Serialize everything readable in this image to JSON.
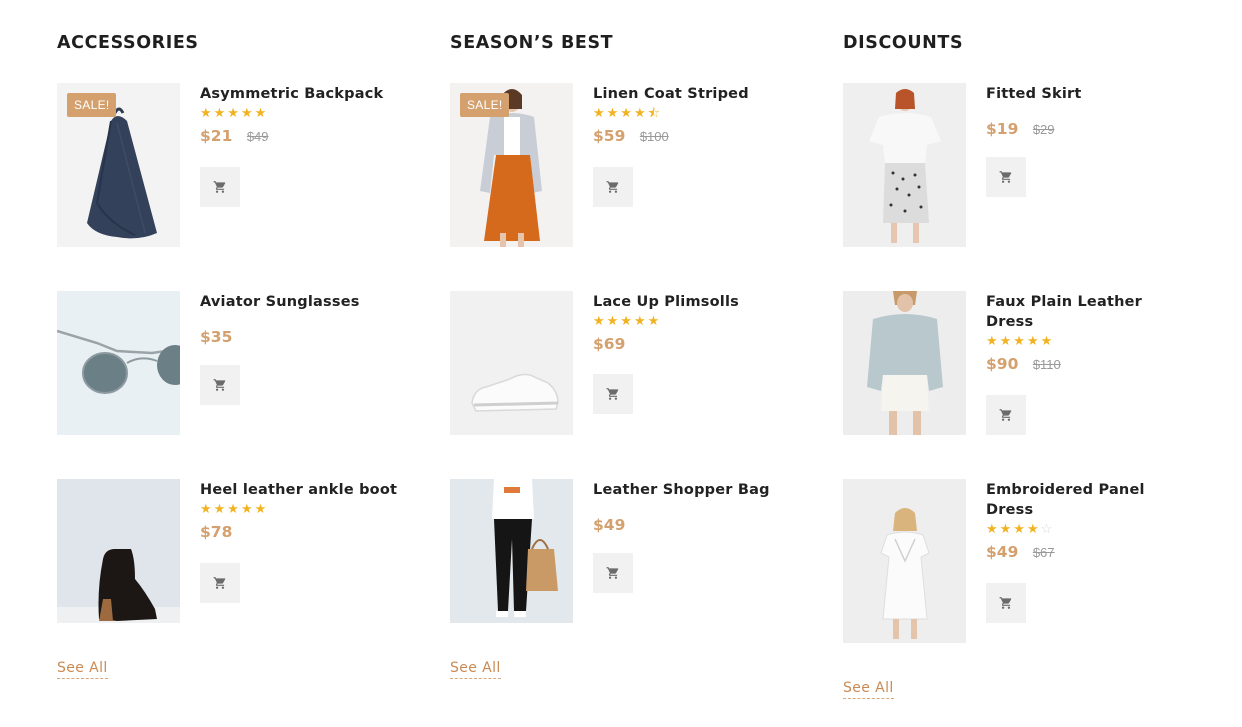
{
  "columns": [
    {
      "title": "ACCESSORIES",
      "see_all": "See All",
      "products": [
        {
          "name": "Asymmetric Backpack",
          "rating": 5,
          "price": "$21",
          "old_price": "$49",
          "badge": "SALE!",
          "image": "backpack"
        },
        {
          "name": "Aviator Sunglasses",
          "rating": null,
          "price": "$35",
          "old_price": "",
          "badge": "",
          "image": "sunglasses"
        },
        {
          "name": "Heel leather ankle boot",
          "rating": 5,
          "price": "$78",
          "old_price": "",
          "badge": "",
          "image": "ankle-boot"
        }
      ]
    },
    {
      "title": "SEASON’S BEST",
      "see_all": "See All",
      "products": [
        {
          "name": "Linen Coat Striped",
          "rating": 4.5,
          "price": "$59",
          "old_price": "$100",
          "badge": "SALE!",
          "image": "coat-model"
        },
        {
          "name": "Lace Up Plimsolls",
          "rating": 5,
          "price": "$69",
          "old_price": "",
          "badge": "",
          "image": "white-sneaker"
        },
        {
          "name": "Leather Shopper Bag",
          "rating": null,
          "price": "$49",
          "old_price": "",
          "badge": "",
          "image": "shopper-bag-model"
        }
      ]
    },
    {
      "title": "DISCOUNTS",
      "see_all": "See All",
      "products": [
        {
          "name": "Fitted Skirt",
          "rating": null,
          "price": "$19",
          "old_price": "$29",
          "badge": "",
          "image": "skirt-model"
        },
        {
          "name": "Faux Plain Leather Dress",
          "rating": 5,
          "price": "$90",
          "old_price": "$110",
          "badge": "",
          "image": "sweater-model"
        },
        {
          "name": "Embroidered Panel Dress",
          "rating": 4,
          "price": "$49",
          "old_price": "$67",
          "badge": "",
          "image": "white-dress-model"
        }
      ]
    }
  ],
  "icons": {
    "cart": "cart-icon",
    "star": "star-icon"
  },
  "colors": {
    "accent": "#d3a06e",
    "star": "#f2b321",
    "button_bg": "#f1f1f1"
  }
}
